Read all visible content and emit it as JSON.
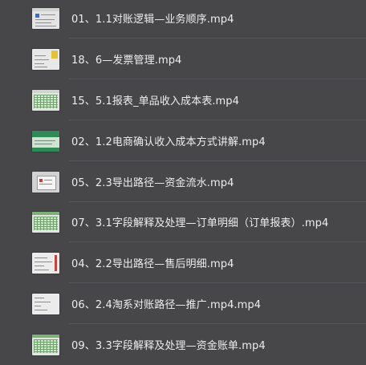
{
  "files": [
    {
      "name": "01、1.1对账逻辑—业务顺序.mp4",
      "thumb": "doc-icon-thumb"
    },
    {
      "name": "18、6—发票管理.mp4",
      "thumb": "yellow-note-thumb"
    },
    {
      "name": "15、5.1报表_单品收入成本表.mp4",
      "thumb": "green-table-thumb"
    },
    {
      "name": "02、1.2电商确认收入成本方式讲解.mp4",
      "thumb": "green-banner-thumb"
    },
    {
      "name": "05、2.3导出路径—资金流水.mp4",
      "thumb": "dialog-thumb"
    },
    {
      "name": "07、3.1字段解释及处理—订单明细（订单报表）.mp4",
      "thumb": "green-table-thumb"
    },
    {
      "name": "04、2.2导出路径—售后明细.mp4",
      "thumb": "red-doc-thumb"
    },
    {
      "name": "06、2.4淘系对账路径—推广.mp4.mp4",
      "thumb": "doc-thumb"
    },
    {
      "name": "09、3.3字段解释及处理—资金账单.mp4",
      "thumb": "green-table-thumb"
    }
  ]
}
